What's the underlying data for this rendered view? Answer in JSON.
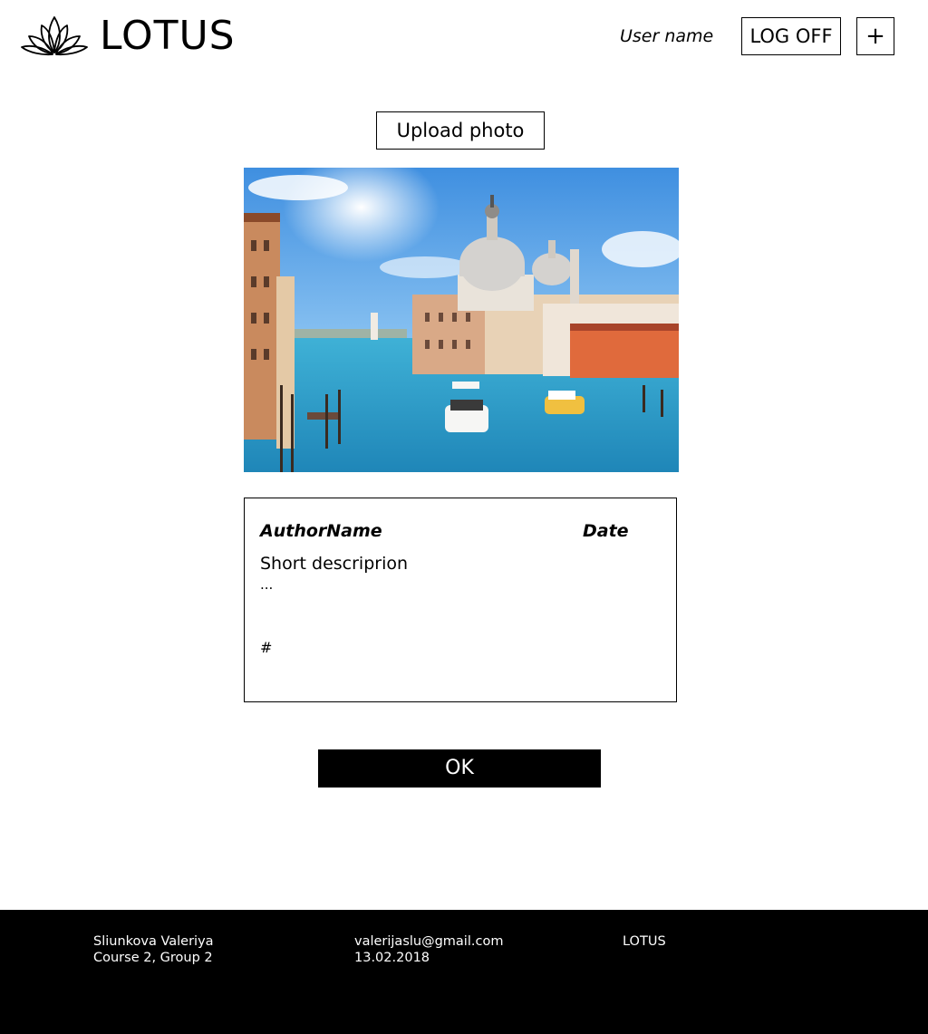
{
  "header": {
    "logo_text": "LOTUS",
    "user_name": "User name",
    "logoff_label": "LOG OFF",
    "add_label": "+"
  },
  "upload": {
    "button_label": "Upload photo"
  },
  "card": {
    "author": "AuthorName",
    "date": "Date",
    "description": "Short descriprion",
    "more": "...",
    "tags": "#"
  },
  "ok_label": "OK",
  "footer": {
    "name": "Sliunkova Valeriya",
    "course": "Course 2, Group 2",
    "email": "valerijaslu@gmail.com",
    "date": "13.02.2018",
    "brand": "LOTUS"
  },
  "colors": {
    "footer_bg": "#000000",
    "ok_bg": "#000000",
    "text": "#000000"
  }
}
